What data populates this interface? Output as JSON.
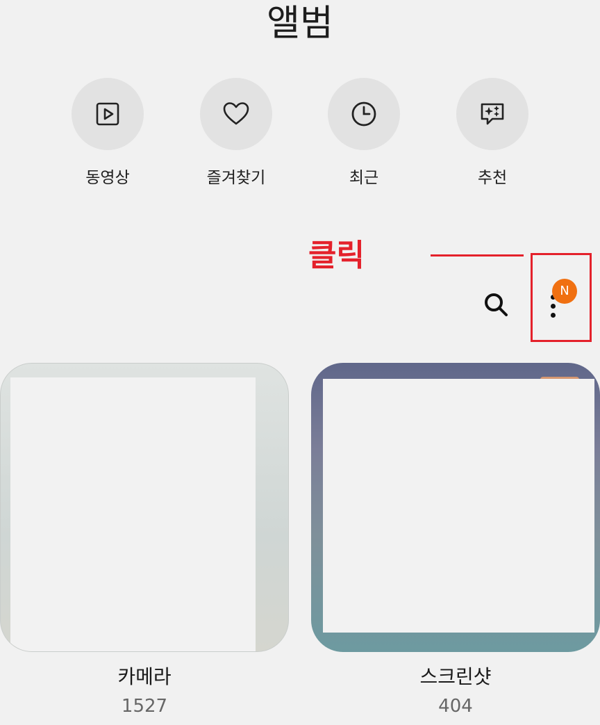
{
  "header": {
    "title": "앨범"
  },
  "quick_access": [
    {
      "label": "동영상",
      "icon": "video-icon"
    },
    {
      "label": "즐겨찾기",
      "icon": "heart-icon"
    },
    {
      "label": "최근",
      "icon": "clock-icon"
    },
    {
      "label": "추천",
      "icon": "sparkle-chat-icon"
    }
  ],
  "annotation": {
    "text": "클릭",
    "color": "#e4212b"
  },
  "toolbar": {
    "search_icon": "search-icon",
    "more_icon": "more-vertical-icon",
    "badge": "N",
    "badge_color": "#f07011"
  },
  "albums": [
    {
      "name": "카메라",
      "count": "1527"
    },
    {
      "name": "스크린샷",
      "count": "404"
    }
  ]
}
